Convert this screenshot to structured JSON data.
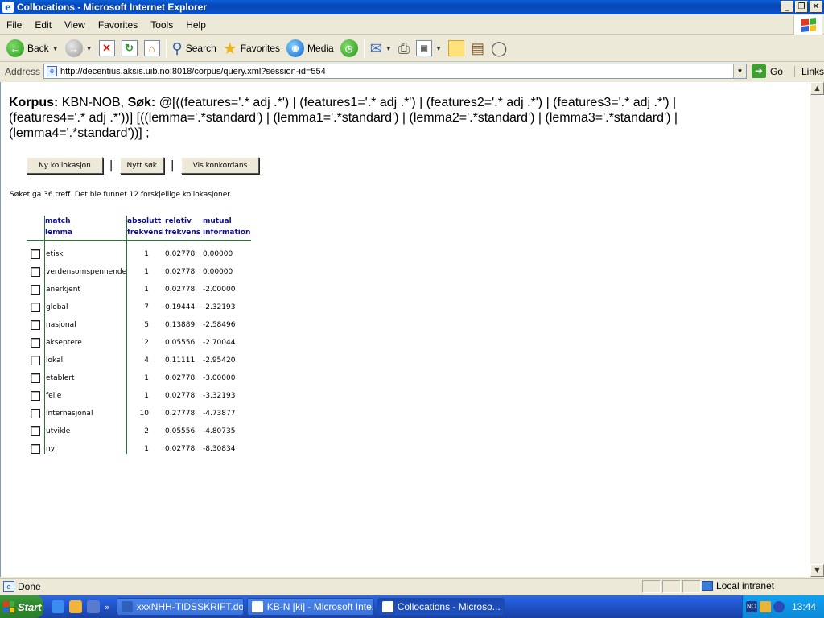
{
  "window": {
    "title": "Collocations - Microsoft Internet Explorer"
  },
  "menu": [
    "File",
    "Edit",
    "View",
    "Favorites",
    "Tools",
    "Help"
  ],
  "toolbar": {
    "back": "Back",
    "search": "Search",
    "favorites": "Favorites",
    "media": "Media"
  },
  "address": {
    "label": "Address",
    "url": "http://decentius.aksis.uib.no:8018/corpus/query.xml?session-id=554",
    "go": "Go",
    "links": "Links"
  },
  "query": {
    "korpus_label": "Korpus:",
    "korpus_value": "KBN-NOB,",
    "sok_label": "Søk:",
    "sok_value": "@[((features='.* adj .*') | (features1='.* adj .*') | (features2='.* adj .*') | (features3='.* adj .*') | (features4='.* adj .*'))] [((lemma='.*standard') | (lemma1='.*standard') | (lemma2='.*standard') | (lemma3='.*standard') | (lemma4='.*standard'))] ;"
  },
  "buttons": {
    "ny_kollokasjon": "Ny kollokasjon",
    "nytt_sok": "Nytt søk",
    "vis_konkordans": "Vis konkordans"
  },
  "summary": "Søket ga 36 treff. Det ble funnet 12 forskjellige kollokasjoner.",
  "table": {
    "headers": {
      "lemma_1": "match",
      "lemma_2": "lemma",
      "abs_1": "absolutt",
      "abs_2": "frekvens",
      "rel_1": "relativ",
      "rel_2": "frekvens",
      "mi_1": "mutual",
      "mi_2": "information"
    },
    "rows": [
      {
        "lemma": "etisk",
        "abs": "1",
        "rel": "0.02778",
        "mi": "0.00000"
      },
      {
        "lemma": "verdensomspennende",
        "abs": "1",
        "rel": "0.02778",
        "mi": "0.00000"
      },
      {
        "lemma": "anerkjent",
        "abs": "1",
        "rel": "0.02778",
        "mi": "-2.00000"
      },
      {
        "lemma": "global",
        "abs": "7",
        "rel": "0.19444",
        "mi": "-2.32193"
      },
      {
        "lemma": "nasjonal",
        "abs": "5",
        "rel": "0.13889",
        "mi": "-2.58496"
      },
      {
        "lemma": "akseptere",
        "abs": "2",
        "rel": "0.05556",
        "mi": "-2.70044"
      },
      {
        "lemma": "lokal",
        "abs": "4",
        "rel": "0.11111",
        "mi": "-2.95420"
      },
      {
        "lemma": "etablert",
        "abs": "1",
        "rel": "0.02778",
        "mi": "-3.00000"
      },
      {
        "lemma": "felle",
        "abs": "1",
        "rel": "0.02778",
        "mi": "-3.32193"
      },
      {
        "lemma": "internasjonal",
        "abs": "10",
        "rel": "0.27778",
        "mi": "-4.73877"
      },
      {
        "lemma": "utvikle",
        "abs": "2",
        "rel": "0.05556",
        "mi": "-4.80735"
      },
      {
        "lemma": "ny",
        "abs": "1",
        "rel": "0.02778",
        "mi": "-8.30834"
      }
    ]
  },
  "status": {
    "text": "Done",
    "zone": "Local intranet"
  },
  "taskbar": {
    "start": "Start",
    "tasks": [
      "xxxNHH-TIDSSKRIFT.do...",
      "KB-N [ki] - Microsoft Inte...",
      "Collocations - Microso..."
    ],
    "tray_badge": "NO",
    "clock": "13:44"
  },
  "colors": {
    "header_text": "#10108c",
    "rule": "#1c7c2a",
    "titlebar": "#0a54d0"
  }
}
